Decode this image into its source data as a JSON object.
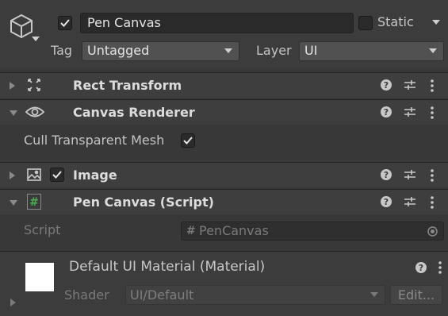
{
  "header": {
    "object_name": "Pen Canvas",
    "active": true,
    "static_label": "Static",
    "tag_label": "Tag",
    "tag_value": "Untagged",
    "layer_label": "Layer",
    "layer_value": "UI",
    "icon": "cube-icon"
  },
  "components": [
    {
      "title": "Rect Transform",
      "expanded": false,
      "icon": "rect-transform-icon"
    },
    {
      "title": "Canvas Renderer",
      "expanded": true,
      "icon": "eye-icon",
      "properties": [
        {
          "label": "Cull Transparent Mesh",
          "checked": true
        }
      ]
    },
    {
      "title": "Image",
      "expanded": false,
      "enabled": true,
      "icon": "image-icon"
    },
    {
      "title": "Pen Canvas (Script)",
      "expanded": true,
      "icon": "script-hash-icon",
      "properties": [
        {
          "label": "Script",
          "value": "PenCanvas"
        }
      ]
    }
  ],
  "material": {
    "title": "Default UI Material (Material)",
    "shader_label": "Shader",
    "shader_value": "UI/Default",
    "edit_label": "Edit..."
  },
  "colors": {
    "background": "#383838",
    "header": "#3e3e3e",
    "script_icon": "#4caf50"
  }
}
